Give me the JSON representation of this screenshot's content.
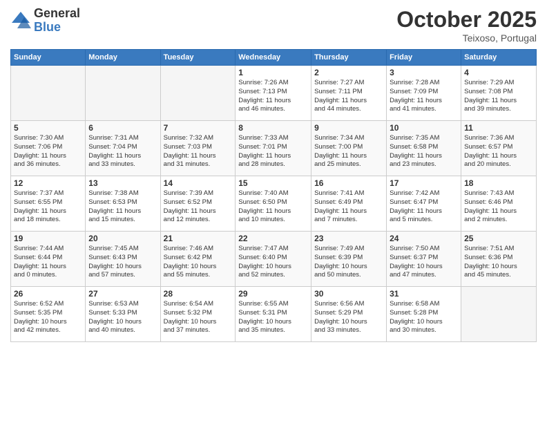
{
  "logo": {
    "general": "General",
    "blue": "Blue"
  },
  "title": "October 2025",
  "subtitle": "Teixoso, Portugal",
  "days_header": [
    "Sunday",
    "Monday",
    "Tuesday",
    "Wednesday",
    "Thursday",
    "Friday",
    "Saturday"
  ],
  "weeks": [
    [
      {
        "day": "",
        "info": ""
      },
      {
        "day": "",
        "info": ""
      },
      {
        "day": "",
        "info": ""
      },
      {
        "day": "1",
        "info": "Sunrise: 7:26 AM\nSunset: 7:13 PM\nDaylight: 11 hours\nand 46 minutes."
      },
      {
        "day": "2",
        "info": "Sunrise: 7:27 AM\nSunset: 7:11 PM\nDaylight: 11 hours\nand 44 minutes."
      },
      {
        "day": "3",
        "info": "Sunrise: 7:28 AM\nSunset: 7:09 PM\nDaylight: 11 hours\nand 41 minutes."
      },
      {
        "day": "4",
        "info": "Sunrise: 7:29 AM\nSunset: 7:08 PM\nDaylight: 11 hours\nand 39 minutes."
      }
    ],
    [
      {
        "day": "5",
        "info": "Sunrise: 7:30 AM\nSunset: 7:06 PM\nDaylight: 11 hours\nand 36 minutes."
      },
      {
        "day": "6",
        "info": "Sunrise: 7:31 AM\nSunset: 7:04 PM\nDaylight: 11 hours\nand 33 minutes."
      },
      {
        "day": "7",
        "info": "Sunrise: 7:32 AM\nSunset: 7:03 PM\nDaylight: 11 hours\nand 31 minutes."
      },
      {
        "day": "8",
        "info": "Sunrise: 7:33 AM\nSunset: 7:01 PM\nDaylight: 11 hours\nand 28 minutes."
      },
      {
        "day": "9",
        "info": "Sunrise: 7:34 AM\nSunset: 7:00 PM\nDaylight: 11 hours\nand 25 minutes."
      },
      {
        "day": "10",
        "info": "Sunrise: 7:35 AM\nSunset: 6:58 PM\nDaylight: 11 hours\nand 23 minutes."
      },
      {
        "day": "11",
        "info": "Sunrise: 7:36 AM\nSunset: 6:57 PM\nDaylight: 11 hours\nand 20 minutes."
      }
    ],
    [
      {
        "day": "12",
        "info": "Sunrise: 7:37 AM\nSunset: 6:55 PM\nDaylight: 11 hours\nand 18 minutes."
      },
      {
        "day": "13",
        "info": "Sunrise: 7:38 AM\nSunset: 6:53 PM\nDaylight: 11 hours\nand 15 minutes."
      },
      {
        "day": "14",
        "info": "Sunrise: 7:39 AM\nSunset: 6:52 PM\nDaylight: 11 hours\nand 12 minutes."
      },
      {
        "day": "15",
        "info": "Sunrise: 7:40 AM\nSunset: 6:50 PM\nDaylight: 11 hours\nand 10 minutes."
      },
      {
        "day": "16",
        "info": "Sunrise: 7:41 AM\nSunset: 6:49 PM\nDaylight: 11 hours\nand 7 minutes."
      },
      {
        "day": "17",
        "info": "Sunrise: 7:42 AM\nSunset: 6:47 PM\nDaylight: 11 hours\nand 5 minutes."
      },
      {
        "day": "18",
        "info": "Sunrise: 7:43 AM\nSunset: 6:46 PM\nDaylight: 11 hours\nand 2 minutes."
      }
    ],
    [
      {
        "day": "19",
        "info": "Sunrise: 7:44 AM\nSunset: 6:44 PM\nDaylight: 11 hours\nand 0 minutes."
      },
      {
        "day": "20",
        "info": "Sunrise: 7:45 AM\nSunset: 6:43 PM\nDaylight: 10 hours\nand 57 minutes."
      },
      {
        "day": "21",
        "info": "Sunrise: 7:46 AM\nSunset: 6:42 PM\nDaylight: 10 hours\nand 55 minutes."
      },
      {
        "day": "22",
        "info": "Sunrise: 7:47 AM\nSunset: 6:40 PM\nDaylight: 10 hours\nand 52 minutes."
      },
      {
        "day": "23",
        "info": "Sunrise: 7:49 AM\nSunset: 6:39 PM\nDaylight: 10 hours\nand 50 minutes."
      },
      {
        "day": "24",
        "info": "Sunrise: 7:50 AM\nSunset: 6:37 PM\nDaylight: 10 hours\nand 47 minutes."
      },
      {
        "day": "25",
        "info": "Sunrise: 7:51 AM\nSunset: 6:36 PM\nDaylight: 10 hours\nand 45 minutes."
      }
    ],
    [
      {
        "day": "26",
        "info": "Sunrise: 6:52 AM\nSunset: 5:35 PM\nDaylight: 10 hours\nand 42 minutes."
      },
      {
        "day": "27",
        "info": "Sunrise: 6:53 AM\nSunset: 5:33 PM\nDaylight: 10 hours\nand 40 minutes."
      },
      {
        "day": "28",
        "info": "Sunrise: 6:54 AM\nSunset: 5:32 PM\nDaylight: 10 hours\nand 37 minutes."
      },
      {
        "day": "29",
        "info": "Sunrise: 6:55 AM\nSunset: 5:31 PM\nDaylight: 10 hours\nand 35 minutes."
      },
      {
        "day": "30",
        "info": "Sunrise: 6:56 AM\nSunset: 5:29 PM\nDaylight: 10 hours\nand 33 minutes."
      },
      {
        "day": "31",
        "info": "Sunrise: 6:58 AM\nSunset: 5:28 PM\nDaylight: 10 hours\nand 30 minutes."
      },
      {
        "day": "",
        "info": ""
      }
    ]
  ]
}
